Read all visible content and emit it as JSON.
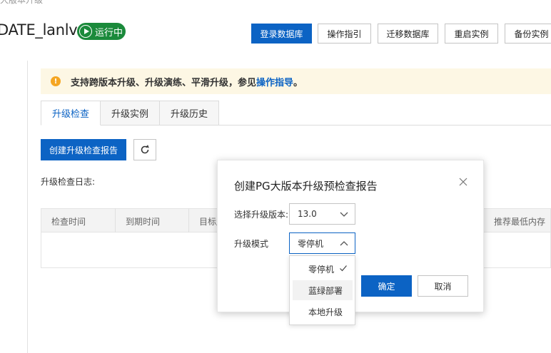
{
  "header": {
    "breadcrumb": "大版本升级",
    "instance_title": "DATE_lanlv",
    "status": "运行中",
    "buttons": {
      "login_db": "登录数据库",
      "guide": "操作指引",
      "migrate_db": "迁移数据库",
      "restart": "重启实例",
      "backup": "备份实例"
    }
  },
  "notice": {
    "text": "支持跨版本升级、升级演练、平滑升级，参见",
    "link": "操作指导",
    "suffix": "。"
  },
  "tabs": [
    "升级检查",
    "升级实例",
    "升级历史"
  ],
  "toolbar": {
    "create_report": "创建升级检查报告"
  },
  "log_label": "升级检查日志:",
  "table": {
    "columns": [
      "检查时间",
      "到期时间",
      "目标版",
      "推荐最低内存"
    ]
  },
  "modal": {
    "title": "创建PG大版本升级预检查报告",
    "version_label": "选择升级版本:",
    "version_value": "13.0",
    "mode_label": "升级模式",
    "mode_value": "零停机",
    "options": [
      "零停机",
      "蓝绿部署",
      "本地升级"
    ],
    "confirm": "确定",
    "cancel": "取消"
  },
  "colors": {
    "primary": "#0c63c4",
    "status_green": "#1b8a3b",
    "notice_bg": "#fdf7e4",
    "warn": "#f5a623"
  }
}
